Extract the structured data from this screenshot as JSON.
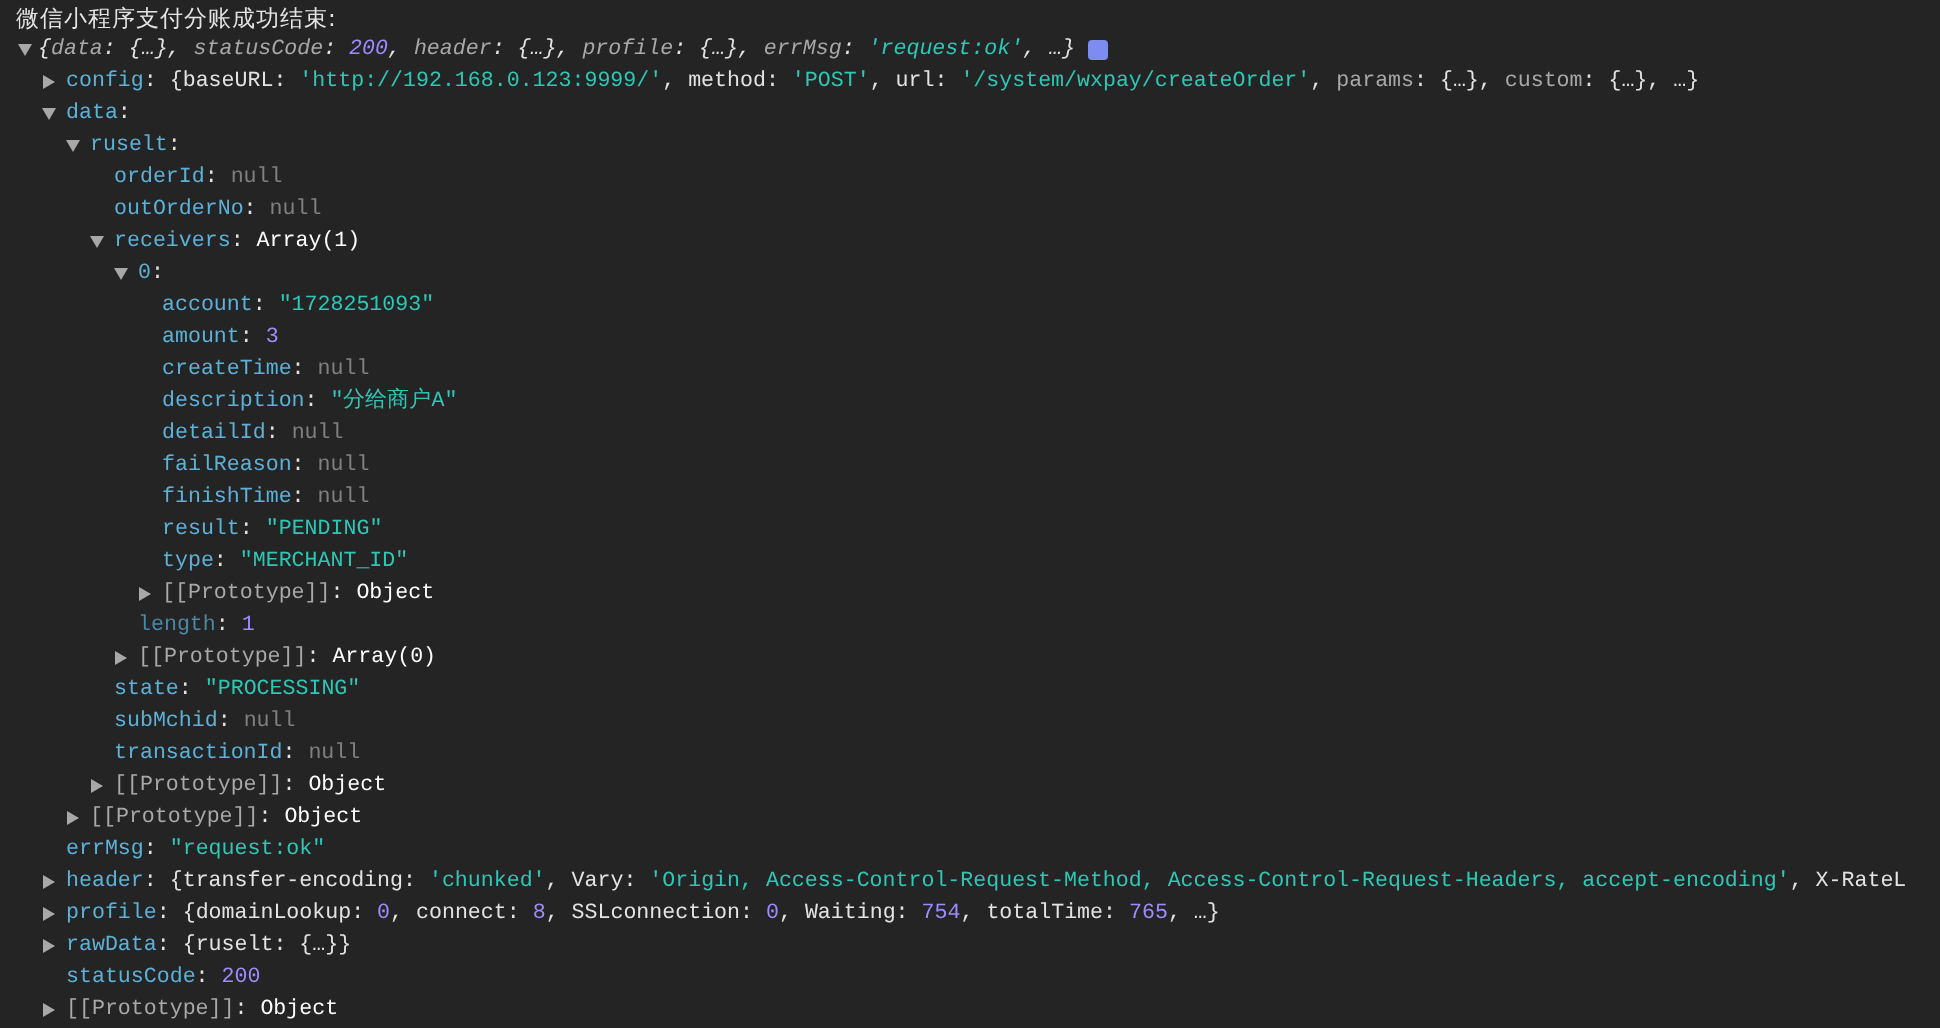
{
  "log": {
    "message": "微信小程序支付分账成功结束:",
    "expanded": true,
    "summary": [
      {
        "kind": "punct",
        "text": "{"
      },
      {
        "kind": "dimkey",
        "text": "data"
      },
      {
        "kind": "punct",
        "text": ": {…}, "
      },
      {
        "kind": "dimkey",
        "text": "statusCode"
      },
      {
        "kind": "punct",
        "text": ": "
      },
      {
        "kind": "number",
        "text": "200"
      },
      {
        "kind": "punct",
        "text": ", "
      },
      {
        "kind": "dimkey",
        "text": "header"
      },
      {
        "kind": "punct",
        "text": ": {…}, "
      },
      {
        "kind": "dimkey",
        "text": "profile"
      },
      {
        "kind": "punct",
        "text": ": {…}, "
      },
      {
        "kind": "dimkey",
        "text": "errMsg"
      },
      {
        "kind": "punct",
        "text": ": "
      },
      {
        "kind": "string",
        "text": "'request:ok'"
      },
      {
        "kind": "punct",
        "text": ", …}"
      }
    ],
    "tree": [
      {
        "key": "config",
        "kind": "property",
        "expanded": false,
        "value": [
          {
            "kind": "punct",
            "text": ": {"
          },
          {
            "kind": "key",
            "text": "baseURL"
          },
          {
            "kind": "punct",
            "text": ": "
          },
          {
            "kind": "string",
            "text": "'http://192.168.0.123:9999/'"
          },
          {
            "kind": "punct",
            "text": ", "
          },
          {
            "kind": "key",
            "text": "method"
          },
          {
            "kind": "punct",
            "text": ": "
          },
          {
            "kind": "string",
            "text": "'POST'"
          },
          {
            "kind": "punct",
            "text": ", "
          },
          {
            "kind": "key",
            "text": "url"
          },
          {
            "kind": "punct",
            "text": ": "
          },
          {
            "kind": "string",
            "text": "'/system/wxpay/createOrder'"
          },
          {
            "kind": "punct",
            "text": ", "
          },
          {
            "kind": "dimkey",
            "text": "params"
          },
          {
            "kind": "punct",
            "text": ": {…}, "
          },
          {
            "kind": "dimkey",
            "text": "custom"
          },
          {
            "kind": "punct",
            "text": ": {…}, …}"
          }
        ]
      },
      {
        "key": "data",
        "kind": "property",
        "expanded": true,
        "value": [
          {
            "kind": "punct",
            "text": ":"
          }
        ],
        "children": [
          {
            "key": "ruselt",
            "kind": "property",
            "expanded": true,
            "value": [
              {
                "kind": "punct",
                "text": ":"
              }
            ],
            "children": [
              {
                "key": "orderId",
                "kind": "property",
                "value": [
                  {
                    "kind": "punct",
                    "text": ": "
                  },
                  {
                    "kind": "null",
                    "text": "null"
                  }
                ]
              },
              {
                "key": "outOrderNo",
                "kind": "property",
                "value": [
                  {
                    "kind": "punct",
                    "text": ": "
                  },
                  {
                    "kind": "null",
                    "text": "null"
                  }
                ]
              },
              {
                "key": "receivers",
                "kind": "property",
                "expanded": true,
                "value": [
                  {
                    "kind": "punct",
                    "text": ": "
                  },
                  {
                    "kind": "type",
                    "text": "Array(1)"
                  }
                ],
                "children": [
                  {
                    "key": "0",
                    "kind": "property",
                    "expanded": true,
                    "value": [
                      {
                        "kind": "punct",
                        "text": ":"
                      }
                    ],
                    "children": [
                      {
                        "key": "account",
                        "kind": "property",
                        "value": [
                          {
                            "kind": "punct",
                            "text": ": "
                          },
                          {
                            "kind": "string",
                            "text": "\"1728251093\""
                          }
                        ]
                      },
                      {
                        "key": "amount",
                        "kind": "property",
                        "value": [
                          {
                            "kind": "punct",
                            "text": ": "
                          },
                          {
                            "kind": "number",
                            "text": "3"
                          }
                        ]
                      },
                      {
                        "key": "createTime",
                        "kind": "property",
                        "value": [
                          {
                            "kind": "punct",
                            "text": ": "
                          },
                          {
                            "kind": "null",
                            "text": "null"
                          }
                        ]
                      },
                      {
                        "key": "description",
                        "kind": "property",
                        "value": [
                          {
                            "kind": "punct",
                            "text": ": "
                          },
                          {
                            "kind": "string",
                            "text": "\"分给商户A\""
                          }
                        ]
                      },
                      {
                        "key": "detailId",
                        "kind": "property",
                        "value": [
                          {
                            "kind": "punct",
                            "text": ": "
                          },
                          {
                            "kind": "null",
                            "text": "null"
                          }
                        ]
                      },
                      {
                        "key": "failReason",
                        "kind": "property",
                        "value": [
                          {
                            "kind": "punct",
                            "text": ": "
                          },
                          {
                            "kind": "null",
                            "text": "null"
                          }
                        ]
                      },
                      {
                        "key": "finishTime",
                        "kind": "property",
                        "value": [
                          {
                            "kind": "punct",
                            "text": ": "
                          },
                          {
                            "kind": "null",
                            "text": "null"
                          }
                        ]
                      },
                      {
                        "key": "result",
                        "kind": "property",
                        "value": [
                          {
                            "kind": "punct",
                            "text": ": "
                          },
                          {
                            "kind": "string",
                            "text": "\"PENDING\""
                          }
                        ]
                      },
                      {
                        "key": "type",
                        "kind": "property",
                        "value": [
                          {
                            "kind": "punct",
                            "text": ": "
                          },
                          {
                            "kind": "string",
                            "text": "\"MERCHANT_ID\""
                          }
                        ]
                      },
                      {
                        "key": "[[Prototype]]",
                        "kind": "internal",
                        "expanded": false,
                        "value": [
                          {
                            "kind": "punct",
                            "text": ": "
                          },
                          {
                            "kind": "type",
                            "text": "Object"
                          }
                        ]
                      }
                    ]
                  },
                  {
                    "key": "length",
                    "kind": "length",
                    "value": [
                      {
                        "kind": "punct",
                        "text": ": "
                      },
                      {
                        "kind": "number",
                        "text": "1"
                      }
                    ]
                  },
                  {
                    "key": "[[Prototype]]",
                    "kind": "internal",
                    "expanded": false,
                    "value": [
                      {
                        "kind": "punct",
                        "text": ": "
                      },
                      {
                        "kind": "type",
                        "text": "Array(0)"
                      }
                    ]
                  }
                ]
              },
              {
                "key": "state",
                "kind": "property",
                "value": [
                  {
                    "kind": "punct",
                    "text": ": "
                  },
                  {
                    "kind": "string",
                    "text": "\"PROCESSING\""
                  }
                ]
              },
              {
                "key": "subMchid",
                "kind": "property",
                "value": [
                  {
                    "kind": "punct",
                    "text": ": "
                  },
                  {
                    "kind": "null",
                    "text": "null"
                  }
                ]
              },
              {
                "key": "transactionId",
                "kind": "property",
                "value": [
                  {
                    "kind": "punct",
                    "text": ": "
                  },
                  {
                    "kind": "null",
                    "text": "null"
                  }
                ]
              },
              {
                "key": "[[Prototype]]",
                "kind": "internal",
                "expanded": false,
                "value": [
                  {
                    "kind": "punct",
                    "text": ": "
                  },
                  {
                    "kind": "type",
                    "text": "Object"
                  }
                ]
              }
            ]
          },
          {
            "key": "[[Prototype]]",
            "kind": "internal",
            "expanded": false,
            "value": [
              {
                "kind": "punct",
                "text": ": "
              },
              {
                "kind": "type",
                "text": "Object"
              }
            ]
          }
        ]
      },
      {
        "key": "errMsg",
        "kind": "property",
        "value": [
          {
            "kind": "punct",
            "text": ": "
          },
          {
            "kind": "string",
            "text": "\"request:ok\""
          }
        ]
      },
      {
        "key": "header",
        "kind": "property",
        "expanded": false,
        "value": [
          {
            "kind": "punct",
            "text": ": {"
          },
          {
            "kind": "key",
            "text": "transfer-encoding"
          },
          {
            "kind": "punct",
            "text": ": "
          },
          {
            "kind": "string",
            "text": "'chunked'"
          },
          {
            "kind": "punct",
            "text": ", "
          },
          {
            "kind": "key",
            "text": "Vary"
          },
          {
            "kind": "punct",
            "text": ": "
          },
          {
            "kind": "string",
            "text": "'Origin, Access-Control-Request-Method, Access-Control-Request-Headers, accept-encoding'"
          },
          {
            "kind": "punct",
            "text": ", "
          },
          {
            "kind": "key",
            "text": "X-RateL"
          }
        ]
      },
      {
        "key": "profile",
        "kind": "property",
        "expanded": false,
        "value": [
          {
            "kind": "punct",
            "text": ": {"
          },
          {
            "kind": "key",
            "text": "domainLookup"
          },
          {
            "kind": "punct",
            "text": ": "
          },
          {
            "kind": "number",
            "text": "0"
          },
          {
            "kind": "punct",
            "text": ", "
          },
          {
            "kind": "key",
            "text": "connect"
          },
          {
            "kind": "punct",
            "text": ": "
          },
          {
            "kind": "number",
            "text": "8"
          },
          {
            "kind": "punct",
            "text": ", "
          },
          {
            "kind": "key",
            "text": "SSLconnection"
          },
          {
            "kind": "punct",
            "text": ": "
          },
          {
            "kind": "number",
            "text": "0"
          },
          {
            "kind": "punct",
            "text": ", "
          },
          {
            "kind": "key",
            "text": "Waiting"
          },
          {
            "kind": "punct",
            "text": ": "
          },
          {
            "kind": "number",
            "text": "754"
          },
          {
            "kind": "punct",
            "text": ", "
          },
          {
            "kind": "key",
            "text": "totalTime"
          },
          {
            "kind": "punct",
            "text": ": "
          },
          {
            "kind": "number",
            "text": "765"
          },
          {
            "kind": "punct",
            "text": ", …}"
          }
        ]
      },
      {
        "key": "rawData",
        "kind": "property",
        "expanded": false,
        "value": [
          {
            "kind": "punct",
            "text": ": {"
          },
          {
            "kind": "key",
            "text": "ruselt"
          },
          {
            "kind": "punct",
            "text": ": {…}}"
          }
        ]
      },
      {
        "key": "statusCode",
        "kind": "property",
        "value": [
          {
            "kind": "punct",
            "text": ": "
          },
          {
            "kind": "number",
            "text": "200"
          }
        ]
      },
      {
        "key": "[[Prototype]]",
        "kind": "internal",
        "expanded": false,
        "value": [
          {
            "kind": "punct",
            "text": ": "
          },
          {
            "kind": "type",
            "text": "Object"
          }
        ]
      }
    ]
  }
}
